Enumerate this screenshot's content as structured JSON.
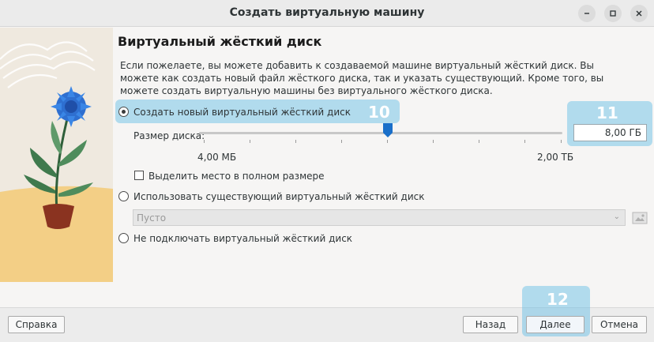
{
  "window": {
    "title": "Создать виртуальную машину",
    "controls": [
      "minimize-icon",
      "maximize-icon",
      "close-icon"
    ]
  },
  "page": {
    "heading": "Виртуальный жёсткий диск",
    "description": "Если пожелаете, вы можете добавить к создаваемой машине виртуальный жёсткий диск. Вы можете как создать новый файл жёсткого диска, так и указать существующий. Кроме того, вы можете создать виртуальную машины без виртуального жёсткого диска."
  },
  "options": {
    "create_new": {
      "label": "Создать новый виртуальный жёсткий диск",
      "checked": true
    },
    "use_existing": {
      "label": "Использовать существующий виртуальный жёсткий диск",
      "checked": false
    },
    "no_disk": {
      "label": "Не подключать виртуальный жёсткий диск",
      "checked": false
    }
  },
  "disk_size": {
    "label": "Размер диска:",
    "value": "8,00 ГБ",
    "min_label": "4,00 МБ",
    "max_label": "2,00 ТБ",
    "slider_fraction": 0.52
  },
  "preallocate": {
    "label": "Выделить место в полном размере",
    "checked": false
  },
  "existing_disk": {
    "selected": "Пусто"
  },
  "annotations": {
    "a10": "10",
    "a11": "11",
    "a12": "12"
  },
  "buttons": {
    "help": "Справка",
    "back": "Назад",
    "next": "Далее",
    "cancel": "Отмена"
  },
  "colors": {
    "highlight": "#78c4e8",
    "slider_handle": "#1a6fc9"
  }
}
